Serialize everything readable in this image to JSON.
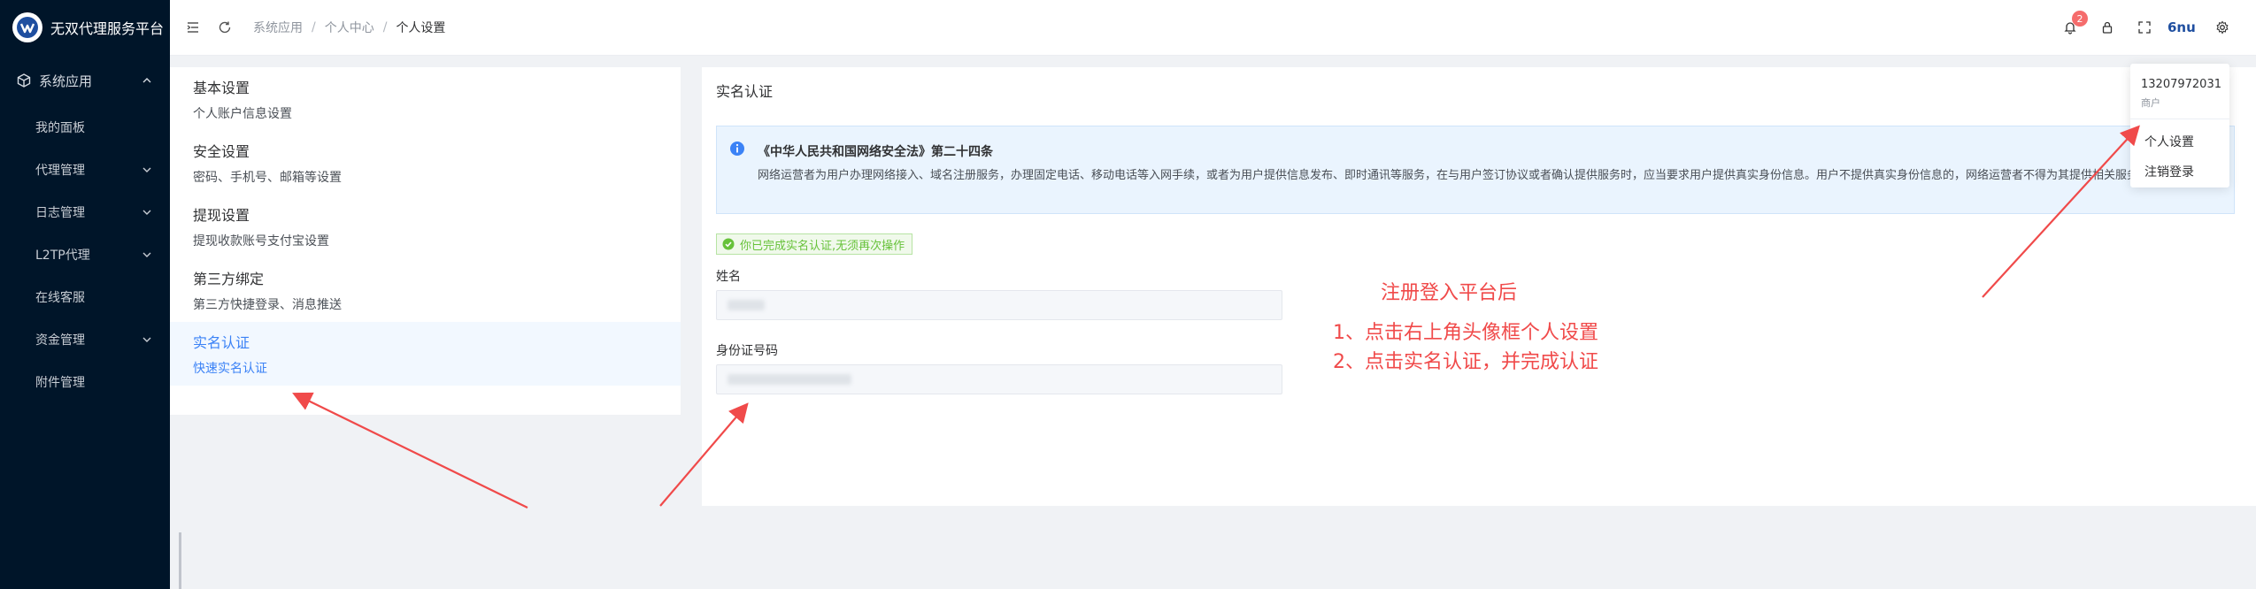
{
  "sidebar": {
    "brand_title": "无双代理服务平台",
    "items": [
      {
        "label": "系统应用",
        "type": "group",
        "expanded": true
      },
      {
        "label": "我的面板",
        "type": "item"
      },
      {
        "label": "代理管理",
        "type": "item",
        "has_children": true
      },
      {
        "label": "日志管理",
        "type": "item",
        "has_children": true
      },
      {
        "label": "L2TP代理",
        "type": "item",
        "has_children": true
      },
      {
        "label": "在线客服",
        "type": "item"
      },
      {
        "label": "资金管理",
        "type": "item",
        "has_children": true
      },
      {
        "label": "附件管理",
        "type": "item"
      }
    ]
  },
  "header": {
    "breadcrumb": [
      "系统应用",
      "个人中心",
      "个人设置"
    ],
    "notification_count": "2",
    "avatar_text": "6nu"
  },
  "settings_menu": [
    {
      "title": "基本设置",
      "desc": "个人账户信息设置"
    },
    {
      "title": "安全设置",
      "desc": "密码、手机号、邮箱等设置"
    },
    {
      "title": "提现设置",
      "desc": "提现收款账号支付宝设置"
    },
    {
      "title": "第三方绑定",
      "desc": "第三方快捷登录、消息推送"
    },
    {
      "title": "实名认证",
      "desc": "快速实名认证",
      "active": true
    }
  ],
  "main": {
    "title": "实名认证",
    "alert_title": "《中华人民共和国网络安全法》第二十四条",
    "alert_body": "网络运营者为用户办理网络接入、域名注册服务，办理固定电话、移动电话等入网手续，或者为用户提供信息发布、即时通讯等服务，在与用户签订协议或者确认提供服务时，应当要求用户提供真实身份信息。用户不提供真实身份信息的，网络运营者不得为其提供相关服务。",
    "success_text": "你已完成实名认证,无须再次操作",
    "name_label": "姓名",
    "id_label": "身份证号码"
  },
  "annotations": {
    "heading": "注册登入平台后",
    "steps": [
      "1、点击右上角头像框个人设置",
      "2、点击实名认证，并完成认证"
    ]
  },
  "user_dropdown": {
    "phone": "13207972031",
    "role": "商户",
    "items": [
      "个人设置",
      "注销登录"
    ]
  },
  "colors": {
    "sidebar_bg": "#001529",
    "accent": "#3b82f6",
    "success": "#67c23a",
    "annotation": "#f04a4a",
    "badge": "#f56c6c"
  }
}
